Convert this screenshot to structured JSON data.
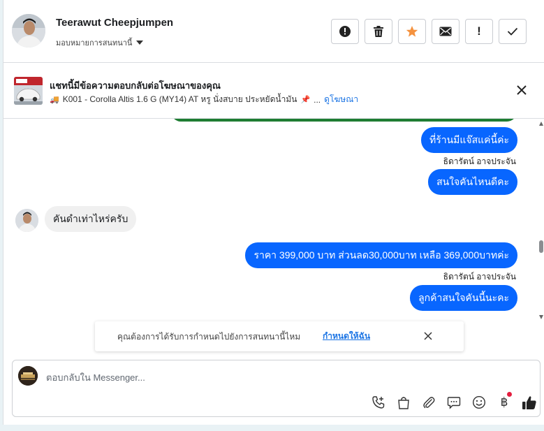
{
  "header": {
    "contact_name": "Teerawut Cheepjumpen",
    "assign_label": "มอบหมายการสนทนานี้",
    "actions": [
      {
        "name": "report-button",
        "icon": "alert-circle-icon"
      },
      {
        "name": "delete-button",
        "icon": "trash-icon"
      },
      {
        "name": "star-button",
        "icon": "star-icon",
        "color": "#f5923e"
      },
      {
        "name": "mail-button",
        "icon": "envelope-icon"
      },
      {
        "name": "mark-important-button",
        "icon": "exclamation-icon",
        "text": "!"
      },
      {
        "name": "mark-done-button",
        "icon": "check-icon"
      }
    ]
  },
  "ad": {
    "title": "แชทนี้มีข้อความตอบกลับต่อโฆษณาของคุณ",
    "vehicle_icon": "🚚",
    "description": "K001 - Corolla Altis 1.6 G (MY14) AT หรู นั่งสบาย ประหยัดน้ำมัน",
    "pin_icon": "📌",
    "ellipsis": "...",
    "link": "ดูโฆษณา"
  },
  "messages": {
    "out_1": "ที่ร้านมีแจ๊สแค่นี้ค่ะ",
    "sender_1": "ธิดารัตน์ อาจประจัน",
    "out_2": "สนใจคันไหนดีคะ",
    "in_1": "คันดำเท่าไหร่ครับ",
    "out_3": "ราคา 399,000 บาท ส่วนลด30,000บาท เหลือ 369,000บาทค่ะ",
    "sender_2": "ธิดารัตน์ อาจประจัน",
    "out_4": "ลูกค้าสนใจคันนี้นะคะ"
  },
  "notice": {
    "text": "คุณต้องการได้รับการกำหนดไปยังการสนทนานี้ไหม",
    "link": "กำหนดให้ฉัน"
  },
  "composer": {
    "placeholder": "ตอบกลับใน Messenger...",
    "baht_symbol": "฿",
    "tools": [
      "phone-add-icon",
      "shopping-bag-icon",
      "paperclip-icon",
      "speech-bubble-icon",
      "smiley-icon",
      "baht-icon",
      "thumbs-up-icon"
    ]
  },
  "colors": {
    "accent": "#0866ff",
    "link": "#1b74e4",
    "star": "#f5923e",
    "notification_dot": "#e41e3f"
  }
}
